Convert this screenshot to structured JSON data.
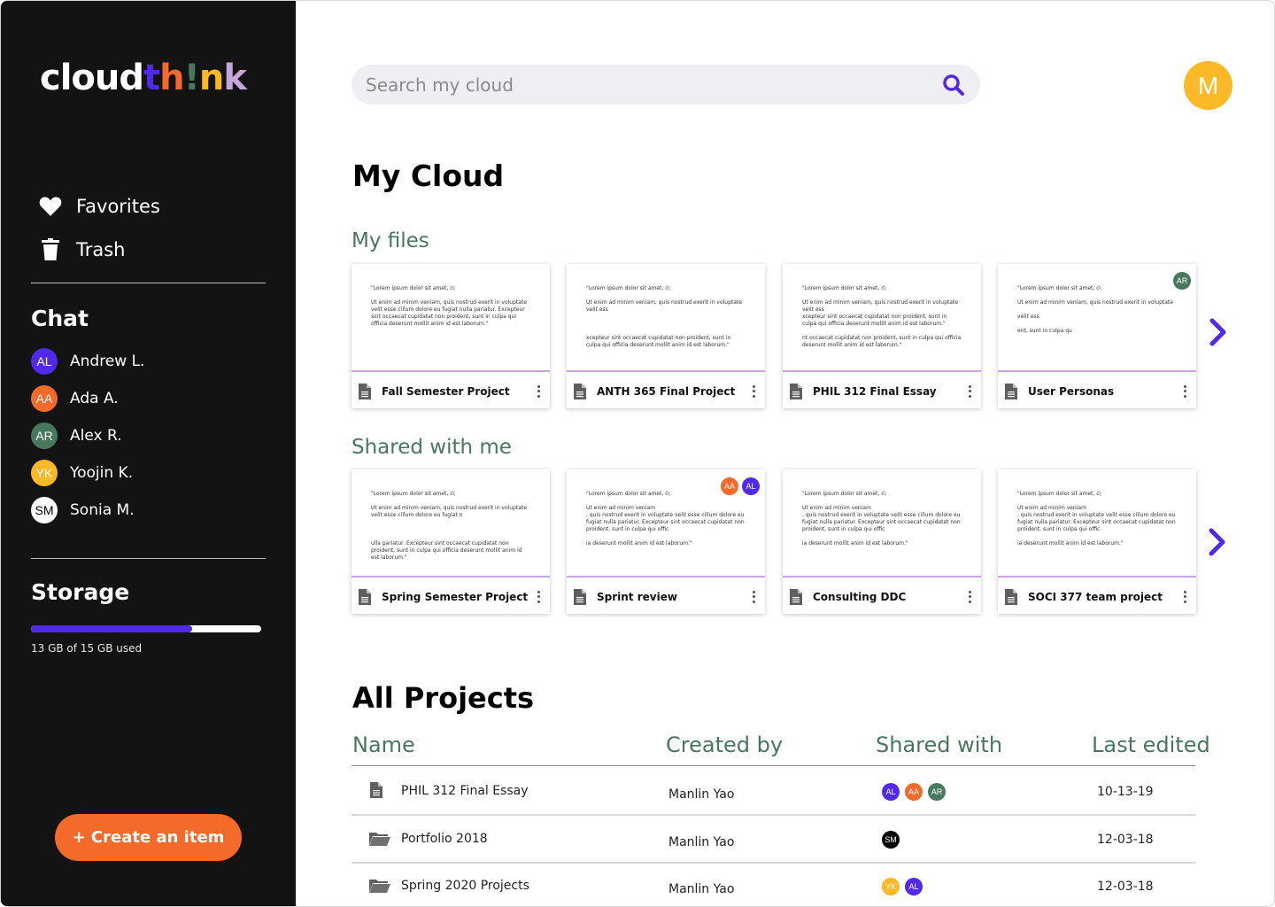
{
  "app": {
    "logo": [
      {
        "text": "cloud",
        "color": "#ffffff"
      },
      {
        "text": "t",
        "color": "#5129e8"
      },
      {
        "text": "h",
        "color": "#f36a2a"
      },
      {
        "text": "!",
        "color": "#47785e"
      },
      {
        "text": "n",
        "color": "#fbb927"
      },
      {
        "text": "k",
        "color": "#c7a6db"
      }
    ]
  },
  "sidebar": {
    "nav": [
      {
        "label": "Favorites",
        "icon": "heart-icon"
      },
      {
        "label": "Trash",
        "icon": "trash-icon"
      }
    ],
    "chat_title": "Chat",
    "chats": [
      {
        "initials": "AL",
        "name": "Andrew L.",
        "color": "#5129e8",
        "text_color": "#ffffff"
      },
      {
        "initials": "AA",
        "name": "Ada A.",
        "color": "#f36a2a",
        "text_color": "#ffffff"
      },
      {
        "initials": "AR",
        "name": "Alex R.",
        "color": "#47785e",
        "text_color": "#ffffff"
      },
      {
        "initials": "YK",
        "name": "Yoojin K.",
        "color": "#fbb927",
        "text_color": "#ffffff"
      },
      {
        "initials": "SM",
        "name": "Sonia M.",
        "color": "#ffffff",
        "text_color": "#000000"
      }
    ],
    "storage_title": "Storage",
    "storage_used_gb": 13,
    "storage_total_gb": 15,
    "storage_fraction": 0.7,
    "storage_text": "13 GB of 15 GB used",
    "create_button": "+ Create an item"
  },
  "header": {
    "search_placeholder": "Search my cloud",
    "search_value": "",
    "user_initial": "M"
  },
  "main": {
    "title": "My Cloud",
    "my_files_title": "My files",
    "my_files": [
      {
        "name": "Fall Semester Project",
        "preview": [
          "\"Lorem ipsum dolor sit amet, c\\",
          "Ut enim ad minim veniam, quis nostrud exerit in voluptate velit esse cillum dolore eu fugiat nulla pariatur. Excepteur sint occaecat cupidatat non proident, sunt in culpa qui officia deserunt mollit anim id est laborum.\""
        ],
        "shared": []
      },
      {
        "name": "ANTH 365 Final Project",
        "preview": [
          "\"Lorem ipsum dolor sit amet, c\\",
          "Ut enim ad minim veniam, quis nostrud exerit in voluptate velit ess",
          "",
          "xcepteur sint occaecat cupidatat non proident, sunt in culpa qui officia deserunt mollit anim id est laborum.\""
        ],
        "shared": []
      },
      {
        "name": "PHIL 312 Final Essay",
        "preview": [
          "\"Lorem ipsum dolor sit amet, c\\",
          "Ut enim ad minim veniam, quis nostrud exerit in voluptate velit ess\nxcepteur sint occaecat cupidatat non proident, sunt in culpa qui officia deserunt mollit anim id est laborum.\"",
          "nt occaecat cupidatat non proident, sunt in culpa qui officia deserunt mollit anim id est laborum.\""
        ],
        "shared": []
      },
      {
        "name": "User Personas",
        "preview": [
          "\"Lorem ipsum dolor sit amet, c\\",
          "Ut enim ad minim veniam, quis nostrud exerit in voluptate",
          "velit ess",
          "ent, sunt in culpa qu"
        ],
        "shared": [
          {
            "initials": "AR",
            "color": "#47785e"
          }
        ]
      }
    ],
    "shared_title": "Shared with me",
    "shared_files": [
      {
        "name": "Spring Semester Project",
        "preview": [
          "\"Lorem ipsum dolor sit amet, c\\",
          "Ut enim ad minim veniam, quis nostrud exerit in voluptate velit esse cillum dolore eu fugiat n",
          "",
          "ulla pariatur. Excepteur sint occaecat cupidatat non proident, sunt in culpa qui officia deserunt mollit anim id est laborum.\""
        ],
        "shared": []
      },
      {
        "name": "Sprint review",
        "preview": [
          "\"Lorem ipsum dolor sit amet, c\\",
          "Ut enim ad minim veniam\n, quis nostrud exerit in voluptate velit esse cillum dolore eu fugiat nulla pariatur. Excepteur sint occaecat cupidatat non proident, sunt in culpa qui offic",
          "ia deserunt mollit anim id est laborum.\""
        ],
        "shared": [
          {
            "initials": "AA",
            "color": "#f36a2a"
          },
          {
            "initials": "AL",
            "color": "#5129e8"
          }
        ]
      },
      {
        "name": "Consulting DDC",
        "preview": [
          "\"Lorem ipsum dolor sit amet, c\\",
          "Ut enim ad minim veniam\n, quis nostrud exerit in voluptate velit esse cillum dolore eu fugiat nulla pariatur. Excepteur sint occaecat cupidatat non proident, sunt in culpa qui offic",
          "ia deserunt mollit anim id est laborum.\""
        ],
        "shared": []
      },
      {
        "name": "SOCI 377 team project",
        "preview": [
          "\"Lorem ipsum dolor sit amet, c\\",
          "Ut enim ad minim veniam\n, quis nostrud exerit in voluptate velit esse cillum dolore eu fugiat nulla pariatur. Excepteur sint occaecat cupidatat non proident, sunt in culpa qui offic",
          "ia deserunt mollit anim id est laborum.\""
        ],
        "shared": []
      }
    ],
    "all_projects_title": "All Projects",
    "table": {
      "headers": [
        "Name",
        "Created by",
        "Shared with",
        "Last edited"
      ],
      "rows": [
        {
          "type": "document",
          "name": "PHIL 312 Final Essay",
          "created_by": "Manlin Yao",
          "shared": [
            {
              "initials": "AL",
              "color": "#5129e8"
            },
            {
              "initials": "AA",
              "color": "#f36a2a"
            },
            {
              "initials": "AR",
              "color": "#47785e"
            }
          ],
          "last_edited": "10-13-19"
        },
        {
          "type": "folder",
          "name": "Portfolio 2018",
          "created_by": "Manlin Yao",
          "shared": [
            {
              "initials": "SM",
              "color": "#000000"
            }
          ],
          "last_edited": "12-03-18"
        },
        {
          "type": "folder",
          "name": "Spring 2020 Projects",
          "created_by": "Manlin Yao",
          "shared": [
            {
              "initials": "YK",
              "color": "#fbb927"
            },
            {
              "initials": "AL",
              "color": "#5129e8"
            }
          ],
          "last_edited": "12-03-18"
        }
      ]
    }
  },
  "colors": {
    "accent": "#5129e8",
    "orange": "#f36a2a",
    "green": "#47785e",
    "yellow": "#fbb927",
    "lavender": "#c7a6db",
    "sidebar_bg": "#131313"
  }
}
